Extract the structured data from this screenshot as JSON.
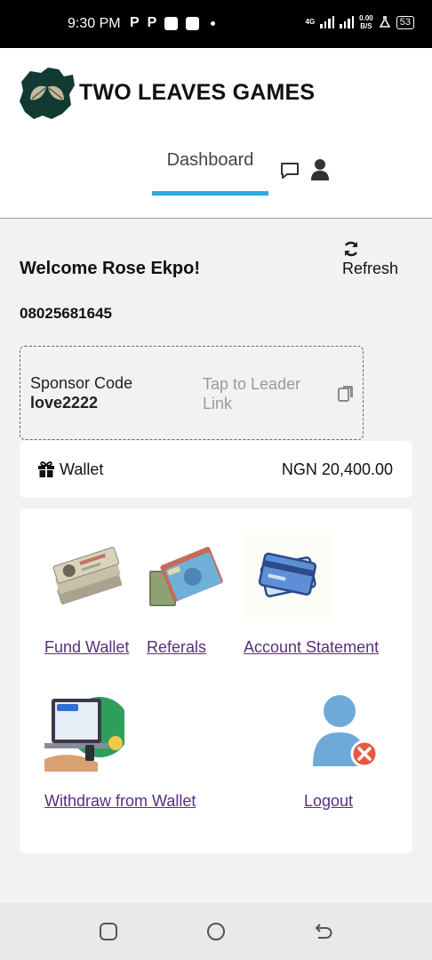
{
  "status_bar": {
    "time": "9:30 PM",
    "app_icons": [
      "P",
      "P"
    ],
    "network": "4G",
    "speed_value": "0.00",
    "speed_unit": "B/S",
    "battery": "53"
  },
  "header": {
    "brand": "TWO LEAVES GAMES",
    "logo_icon": "nigeria-map-leaves-logo",
    "tabs": [
      {
        "label": "Dashboard",
        "active": true
      }
    ],
    "accent_color": "#29abe2"
  },
  "dashboard": {
    "welcome": "Welcome Rose Ekpo!",
    "phone": "08025681645",
    "refresh_label": "Refresh",
    "sponsor": {
      "title": "Sponsor Code",
      "code": "love2222",
      "leader_link": "Tap to Leader Link"
    },
    "wallet": {
      "label": "Wallet",
      "balance": "NGN 20,400.00"
    },
    "menu": [
      {
        "label": "Fund Wallet",
        "icon": "cash-stack-icon"
      },
      {
        "label": "Referals",
        "icon": "money-bundle-icon"
      },
      {
        "label": "Account Statement",
        "icon": "credit-card-icon"
      },
      {
        "label": "Withdraw from Wallet",
        "icon": "cashout-laptop-icon"
      },
      {
        "label": "Logout",
        "icon": "user-remove-icon"
      }
    ],
    "link_color": "#5a2d82"
  }
}
